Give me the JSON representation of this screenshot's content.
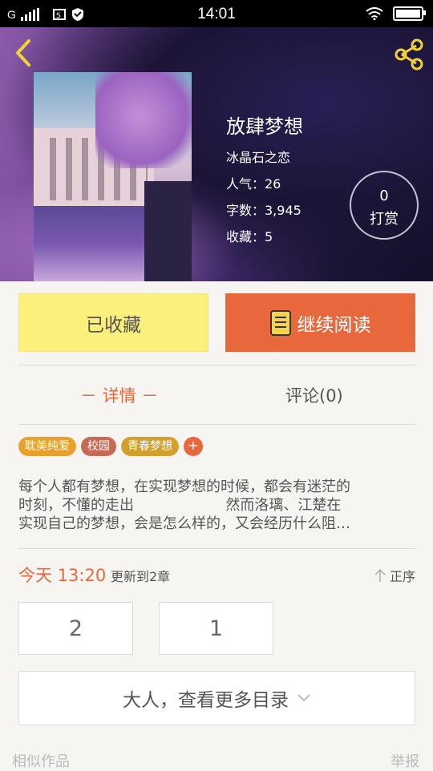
{
  "status_bar": {
    "carrier": "G",
    "time": "14:01"
  },
  "colors": {
    "accent": "#e8683d",
    "collected_bg": "#fbf07b",
    "hero_start": "#8a5aa8",
    "hero_end": "#130f28"
  },
  "header": {
    "back_icon": "chevron-left-icon",
    "share_icon": "share-icon"
  },
  "book": {
    "title": "放肆梦想",
    "author": "冰晶石之恋",
    "popularity": "人气：26",
    "word_count": "字数：3,945",
    "favorites": "收藏：5"
  },
  "tip": {
    "count": "0",
    "label": "打赏"
  },
  "actions": {
    "collected_label": "已收藏",
    "continue_label": "继续阅读"
  },
  "tabs": [
    {
      "label": "－ 详情 －"
    },
    {
      "label": "评论(0)"
    }
  ],
  "tags": [
    {
      "label": "耽美纯爱",
      "color": "#e8a22c"
    },
    {
      "label": "校园",
      "color": "#c66a54"
    },
    {
      "label": "青春梦想",
      "color": "#d4a02c"
    }
  ],
  "tag_add_label": "+",
  "description": [
    "每个人都有梦想，在实现梦想的时候，都会有迷茫的",
    "时刻，不懂的走出                    然而洛璃、江楚在",
    "实现自己的梦想，会是怎么样的，又会经历什么阻…"
  ],
  "update": {
    "time": "今天 13:20",
    "text": "更新到2章",
    "sort_label": "正序"
  },
  "chapters": [
    {
      "label": "2"
    },
    {
      "label": "1"
    }
  ],
  "more_catalog_label": "大人，查看更多目录",
  "footer": {
    "similar_label": "相似作品",
    "report_label": "举报"
  }
}
